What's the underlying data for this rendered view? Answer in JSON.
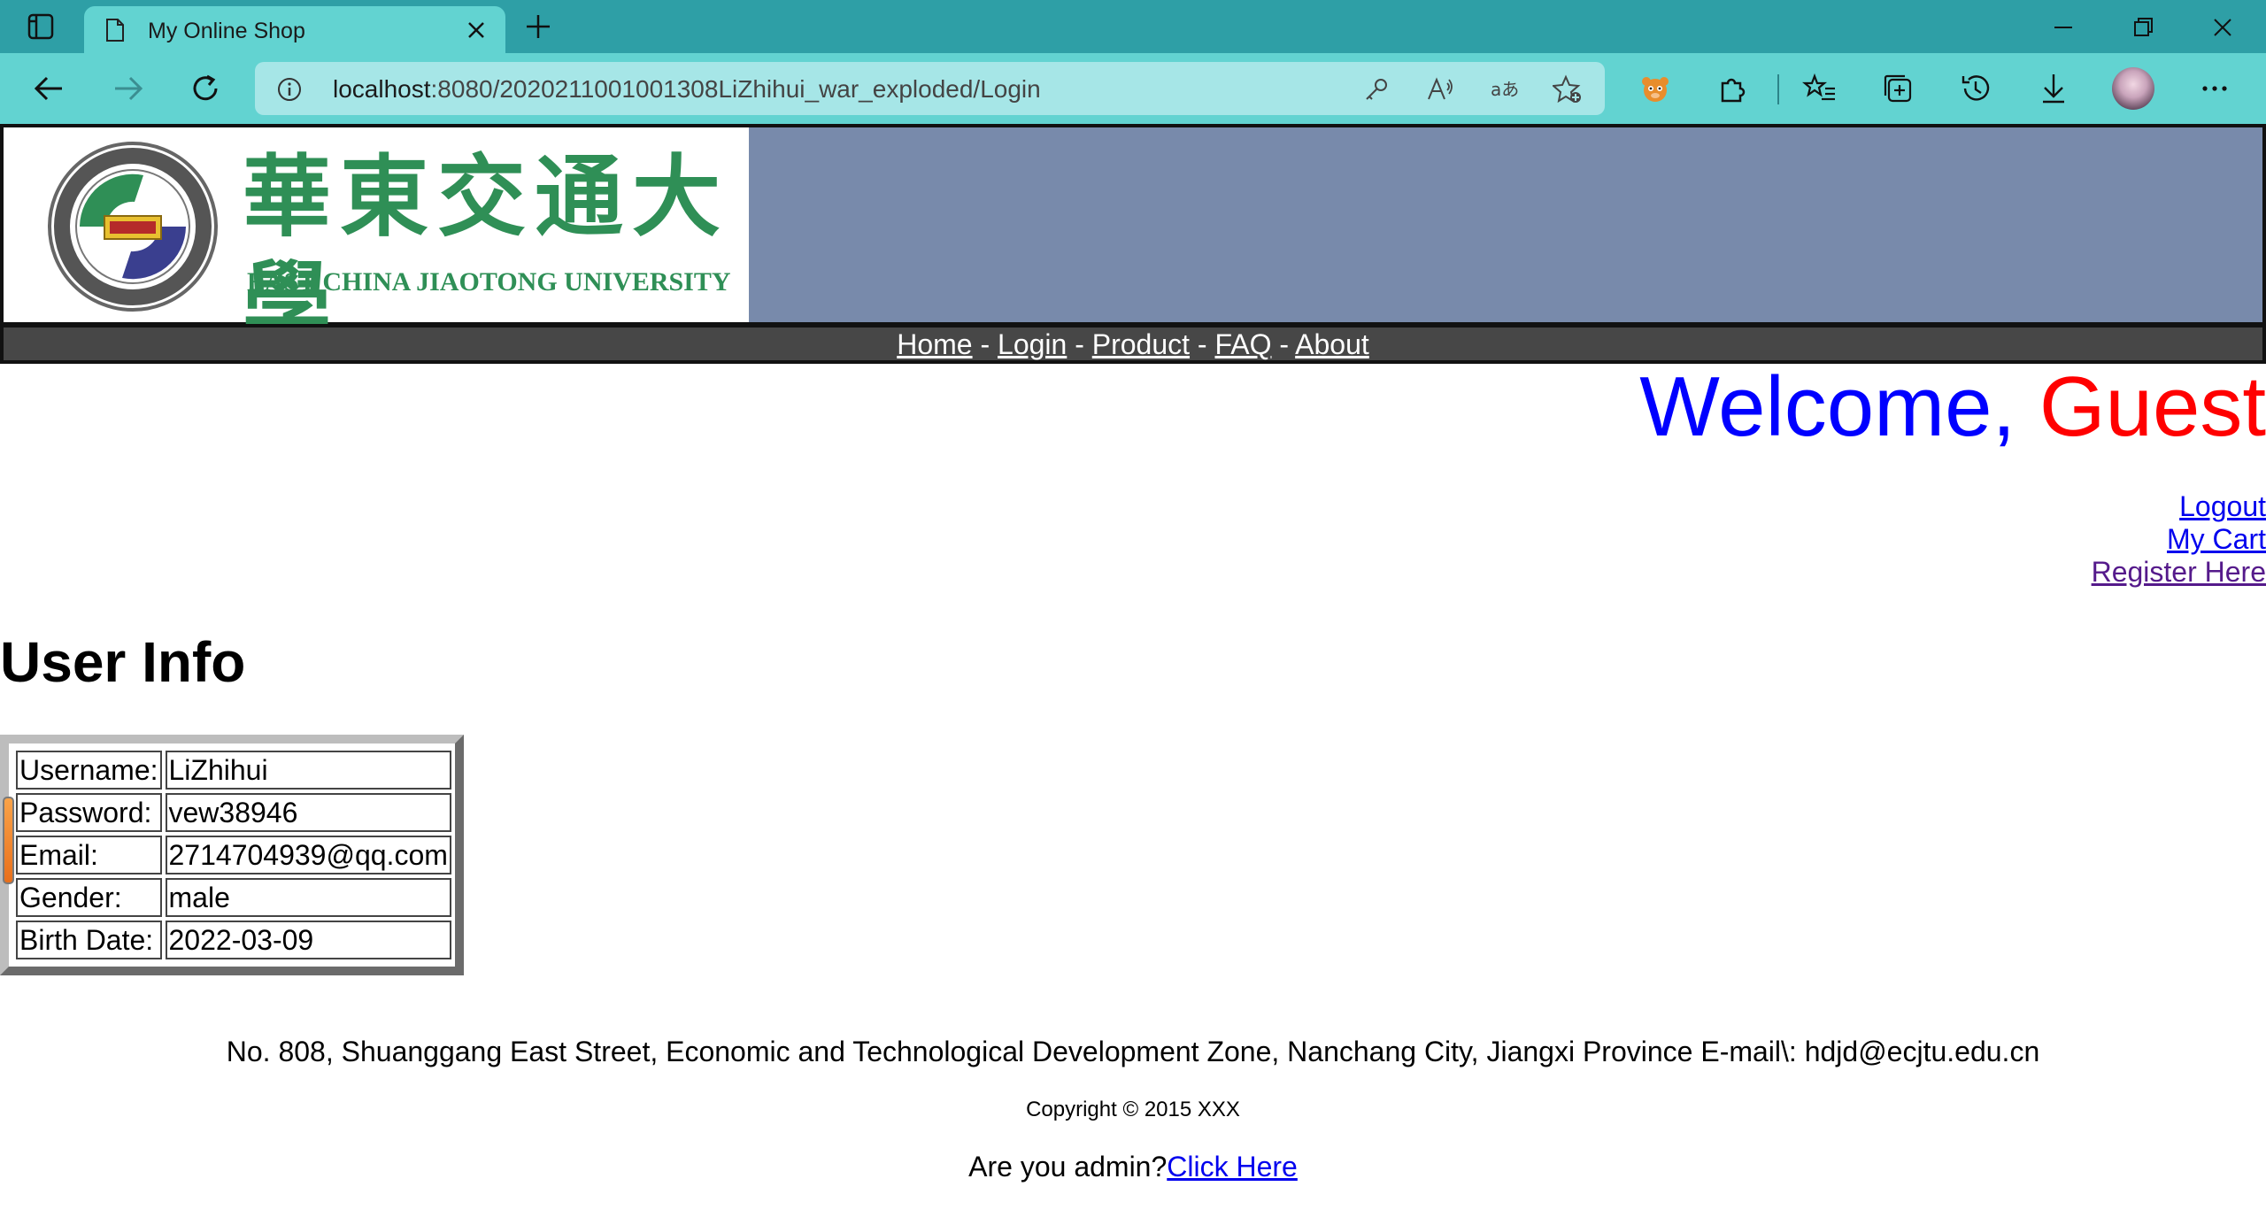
{
  "browser": {
    "tab_title": "My Online Shop",
    "url_host": "localhost",
    "url_rest": ":8080/202021100100130​8LiZhihui_war_exploded/Login"
  },
  "banner": {
    "logo_cn": "華東交通大學",
    "logo_en": "EAST CHINA JIAOTONG UNIVERSITY",
    "seal_text": "EAST CHINA JIAOTONG UNIVERSITY"
  },
  "nav": {
    "items": [
      "Home",
      "Login",
      "Product",
      "FAQ",
      "About"
    ],
    "separator": " - "
  },
  "welcome": {
    "prefix": "Welcome, ",
    "name": "Guest"
  },
  "account_links": {
    "logout": "Logout",
    "cart": "My Cart",
    "register": "Register Here"
  },
  "user_info": {
    "heading": "User Info",
    "rows": [
      {
        "label": "Username:",
        "value": "LiZhihui"
      },
      {
        "label": "Password:",
        "value": "vew38946"
      },
      {
        "label": "Email:",
        "value": "2714704939@qq.com"
      },
      {
        "label": "Gender:",
        "value": "male"
      },
      {
        "label": "Birth Date:",
        "value": "2022-03-09"
      }
    ]
  },
  "footer": {
    "address": "No. 808, Shuanggang East Street, Economic and Technological Development Zone, Nanchang City, Jiangxi Province E-mail\\: hdjd@ecjtu.edu.cn",
    "copyright": "Copyright © 2015 XXX",
    "admin_prompt": "Are you admin?",
    "admin_link": "Click Here"
  },
  "colors": {
    "tabbar": "#2e9fa6",
    "toolbar": "#62d3d1",
    "banner_bg": "#788aab",
    "logo_green": "#2f8f56",
    "welcome_blue": "#0000ff",
    "welcome_red": "#ff0000"
  }
}
